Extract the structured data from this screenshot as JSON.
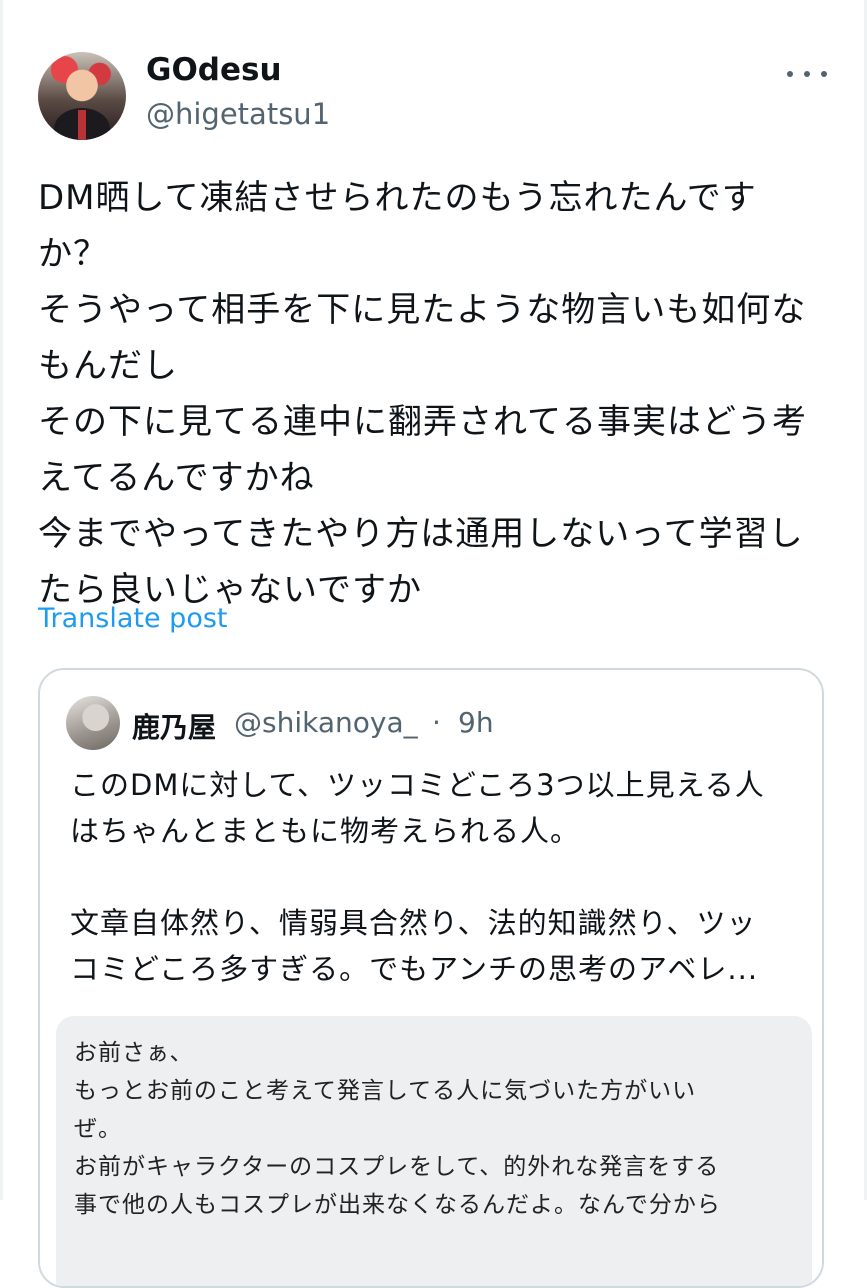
{
  "post": {
    "display_name": "GOdesu",
    "handle": "@higetatsu1",
    "more_icon": "more-horizontal-icon",
    "text_lines": [
      "DM晒して凍結させられたのもう忘れたんです",
      "か？",
      "そうやって相手を下に見たような物言いも如何な",
      "もんだし",
      "その下に見てる連中に翻弄されてる事実はどう考",
      "えてるんですかね",
      "今までやってきたやり方は通用しないって学習し",
      "たら良いじゃないですか"
    ],
    "translate_label": "Translate post"
  },
  "quote": {
    "display_name": "鹿乃屋",
    "handle": "@shikanoya_",
    "separator": "·",
    "time": "9h",
    "text_lines": [
      "このDMに対して、ツッコミどころ3つ以上見える人",
      "はちゃんとまともに物考えられる人。",
      "",
      "文章自体然り、情弱具合然り、法的知識然り、ツッ",
      "コミどころ多すぎる。でもアンチの思考のアベレ..."
    ],
    "image_text_lines": [
      "お前さぁ、",
      "もっとお前のこと考えて発言してる人に気づいた方がいい",
      "ぜ。",
      "お前がキャラクターのコスプレをして、的外れな発言をする",
      "事で他の人もコスプレが出来なくなるんだよ。なんで分から"
    ]
  },
  "colors": {
    "accent": "#1d9bf0",
    "secondary_text": "#536471",
    "border": "#cfd9de"
  }
}
